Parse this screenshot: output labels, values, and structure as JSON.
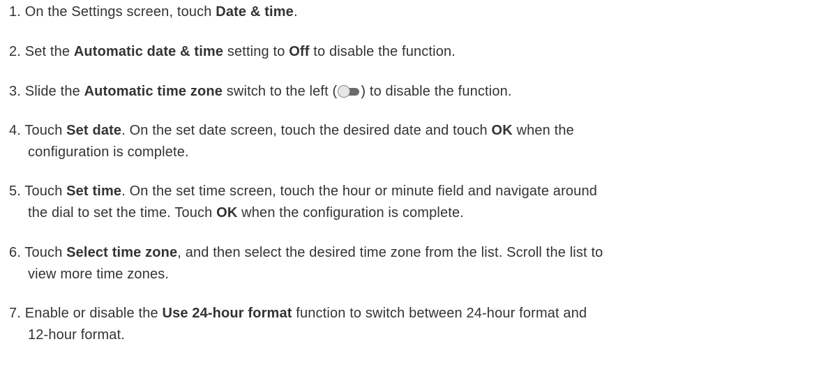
{
  "steps": [
    {
      "num": "1.",
      "t1": "On the Settings screen, touch ",
      "b1": "Date & time",
      "t2": "."
    },
    {
      "num": "2.",
      "t1": "Set the ",
      "b1": "Automatic date & time",
      "t2": " setting to ",
      "b2": "Off",
      "t3": " to disable the function."
    },
    {
      "num": "3.",
      "t1": "Slide the ",
      "b1": "Automatic time zone",
      "t2": " switch to the left (",
      "icon": "toggle-off-icon",
      "t3": ") to disable the function."
    },
    {
      "num": "4.",
      "t1": "Touch ",
      "b1": "Set date",
      "t2": ". On the set date screen, touch the desired date and touch ",
      "b2": "OK",
      "t3": " when the",
      "t4": "configuration is complete."
    },
    {
      "num": "5.",
      "t1": "Touch ",
      "b1": "Set time",
      "t2": ". On the set time screen, touch the hour or minute field and navigate around",
      "t3": "the dial to set the time. Touch ",
      "b2": "OK",
      "t4": " when the configuration is complete."
    },
    {
      "num": "6.",
      "t1": "Touch ",
      "b1": "Select time zone",
      "t2": ", and then select the desired time zone from the list. Scroll the list to",
      "t3": "view more time zones."
    },
    {
      "num": "7.",
      "t1": "Enable or disable the ",
      "b1": "Use 24-hour format",
      "t2": " function to switch between 24-hour format and",
      "t3": "12-hour format."
    }
  ]
}
